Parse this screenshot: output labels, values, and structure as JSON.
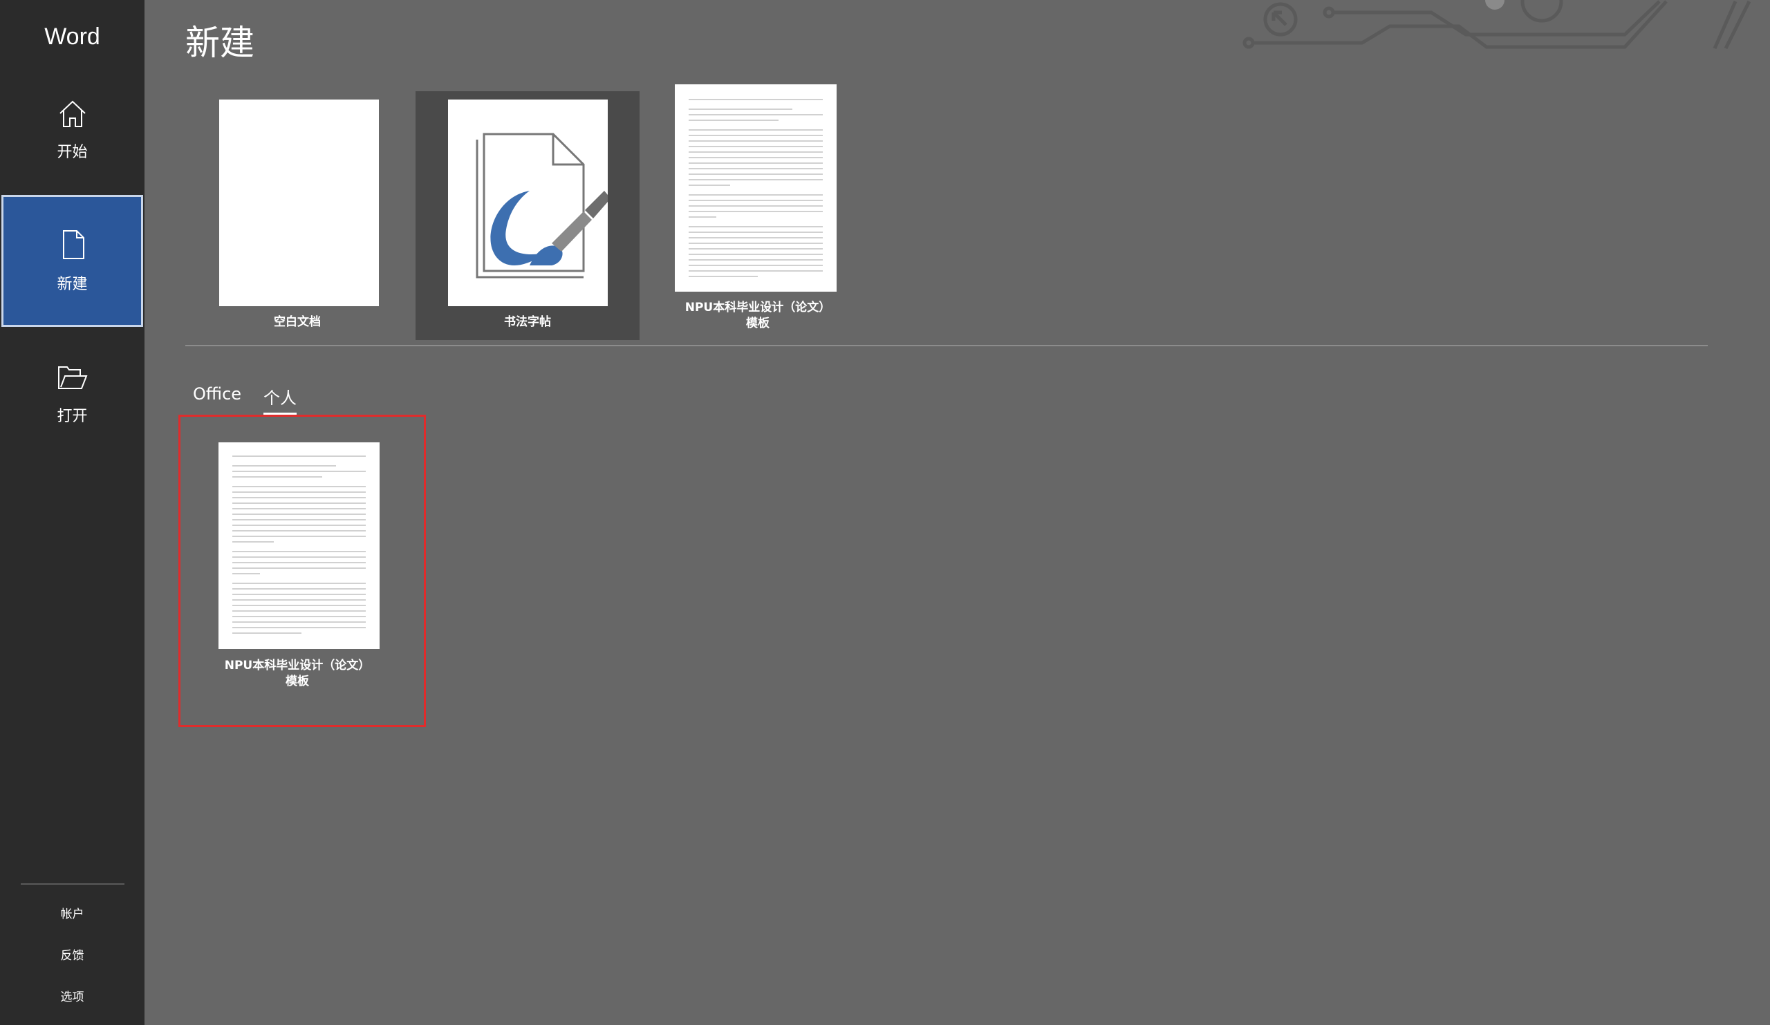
{
  "sidebar": {
    "app_title": "Word",
    "nav": [
      {
        "label": "开始",
        "icon": "home-icon"
      },
      {
        "label": "新建",
        "icon": "new-document-icon"
      },
      {
        "label": "打开",
        "icon": "open-folder-icon"
      }
    ],
    "bottom_links": [
      "帐户",
      "反馈",
      "选项"
    ]
  },
  "main": {
    "title": "新建",
    "featured_templates": [
      {
        "label": "空白文档",
        "icon": "blank-document-thumbnail"
      },
      {
        "label": "书法字帖",
        "icon": "calligraphy-brush-thumbnail"
      },
      {
        "label_line1": "NPU本科毕业设计（论文）",
        "label_line2": "模板",
        "icon": "text-document-thumbnail"
      }
    ],
    "tabs": [
      {
        "label": "Office",
        "active": false
      },
      {
        "label": "个人",
        "active": true
      }
    ],
    "personal_templates": [
      {
        "label_line1": "NPU本科毕业设计（论文）",
        "label_line2": "模板",
        "icon": "text-document-thumbnail"
      }
    ]
  },
  "colors": {
    "sidebar_bg": "#2b2b2b",
    "selected_nav_bg": "#2b579a",
    "main_bg": "#676767",
    "highlight_border": "#e02c2c",
    "calligraphy_blue": "#3d6fb0"
  }
}
